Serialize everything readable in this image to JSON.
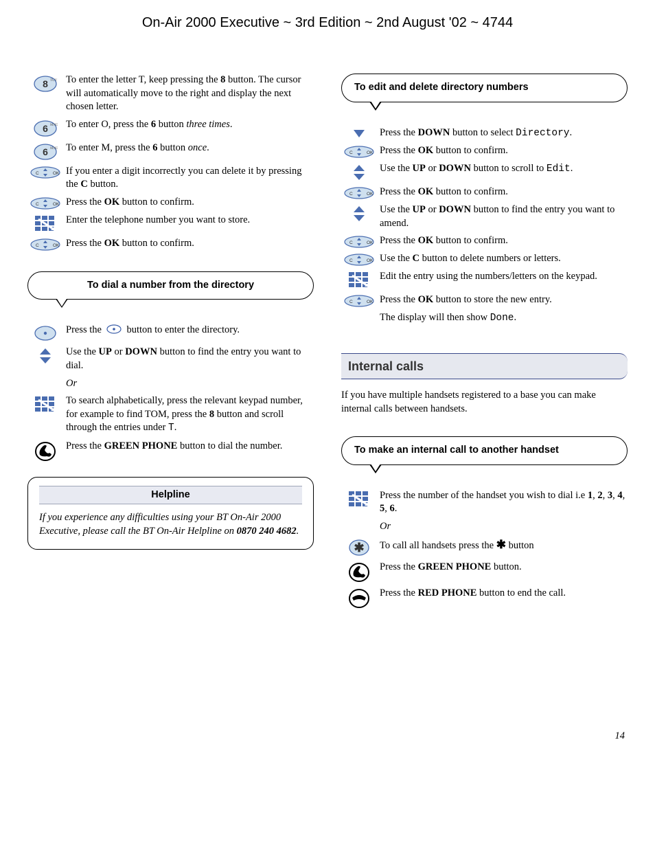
{
  "header": "On-Air 2000 Executive ~ 3rd Edition ~ 2nd August '02 ~ 4744",
  "page_number": "14",
  "left_col": {
    "steps_a": [
      {
        "icon": "key-8",
        "html": "To enter the letter T, keep pressing the <b>8</b> button. The cursor will automatically move to the right and display the next chosen letter."
      },
      {
        "icon": "key-6",
        "html": "To enter O, press the <b>6</b> button <i>three times</i>."
      },
      {
        "icon": "key-6",
        "html": "To enter M, press the <b>6</b> button <i>once</i>."
      },
      {
        "icon": "c-ok",
        "html": "If you enter a digit incorrectly you can delete it by pressing the <b>C</b> button."
      },
      {
        "icon": "c-ok",
        "html": "Press the <b>OK</b> button to confirm."
      },
      {
        "icon": "keypad",
        "html": "Enter the telephone number you want to store."
      },
      {
        "icon": "c-ok",
        "html": "Press the <b>OK</b> button to confirm."
      }
    ],
    "callout_dial": "To dial a number from the directory",
    "steps_b": [
      {
        "icon": "dot",
        "html": "Press the &nbsp;<svg width='22' height='14' style='vertical-align:-2px'><ellipse cx='11' cy='7' rx='10' ry='6' fill='none' stroke='#3a5da8' stroke-width='1.2'/><circle cx='11' cy='7' r='1.8' fill='#3a5da8'/></svg>&nbsp; button to enter the directory."
      },
      {
        "icon": "updown",
        "html": "Use the <b>UP</b> or <b>DOWN</b> button to find the entry you want to dial."
      },
      {
        "icon": "",
        "html": "<i>Or</i>"
      },
      {
        "icon": "keypad",
        "html": "To search alphabetically, press the relevant keypad number, for example to find TOM, press the <b>8</b> button and scroll through the entries under <span class='mono'>T</span>."
      },
      {
        "icon": "green-phone",
        "html": "Press the <b>GREEN PHONE</b> button to dial the number."
      }
    ],
    "helpline_title": "Helpline",
    "helpline_html": "If you experience any difficulties using your BT On-Air 2000 Executive, please call the BT On-Air Helpline on <b>0870 240 4682</b>."
  },
  "right_col": {
    "callout_edit": "To edit and delete directory numbers",
    "steps_c": [
      {
        "icon": "down",
        "html": "Press the <b>DOWN</b> button to select <span class='mono'>Directory</span>."
      },
      {
        "icon": "c-ok",
        "html": "Press the <b>OK</b> button to confirm."
      },
      {
        "icon": "updown",
        "html": "Use the <b>UP</b> or <b>DOWN</b> button to scroll to <span class='mono'>Edit</span>."
      },
      {
        "icon": "c-ok",
        "html": "Press the <b>OK</b> button to confirm."
      },
      {
        "icon": "updown",
        "html": "Use the <b>UP</b> or <b>DOWN</b> button to find the entry you want to amend."
      },
      {
        "icon": "c-ok",
        "html": "Press the <b>OK</b> button to confirm."
      },
      {
        "icon": "c-ok",
        "html": "Use the <b>C</b> button to delete numbers or letters."
      },
      {
        "icon": "keypad",
        "html": "Edit the entry using the numbers/letters on the keypad."
      },
      {
        "icon": "c-ok",
        "html": "Press the <b>OK</b> button to store the new entry."
      },
      {
        "icon": "",
        "html": "The display will then show <span class='mono'>Done</span>."
      }
    ],
    "section_header": "Internal calls",
    "section_intro": "If you have multiple handsets registered to a base you can make internal calls between handsets.",
    "callout_internal": "To make an internal call to another handset",
    "steps_d": [
      {
        "icon": "keypad",
        "html": "Press the number of the handset you wish to dial i.e <b>1</b>, <b>2</b>, <b>3</b>, <b>4</b>, <b>5</b>, <b>6</b>."
      },
      {
        "icon": "",
        "html": "<i>Or</i>"
      },
      {
        "icon": "star",
        "html": "To call all handsets press the <b style='font-size:17px'>&#10033;</b> button"
      },
      {
        "icon": "green-phone",
        "html": "Press the <b>GREEN PHONE</b> button."
      },
      {
        "icon": "red-phone",
        "html": "Press the <b>RED PHONE</b> button to end the call."
      }
    ]
  }
}
